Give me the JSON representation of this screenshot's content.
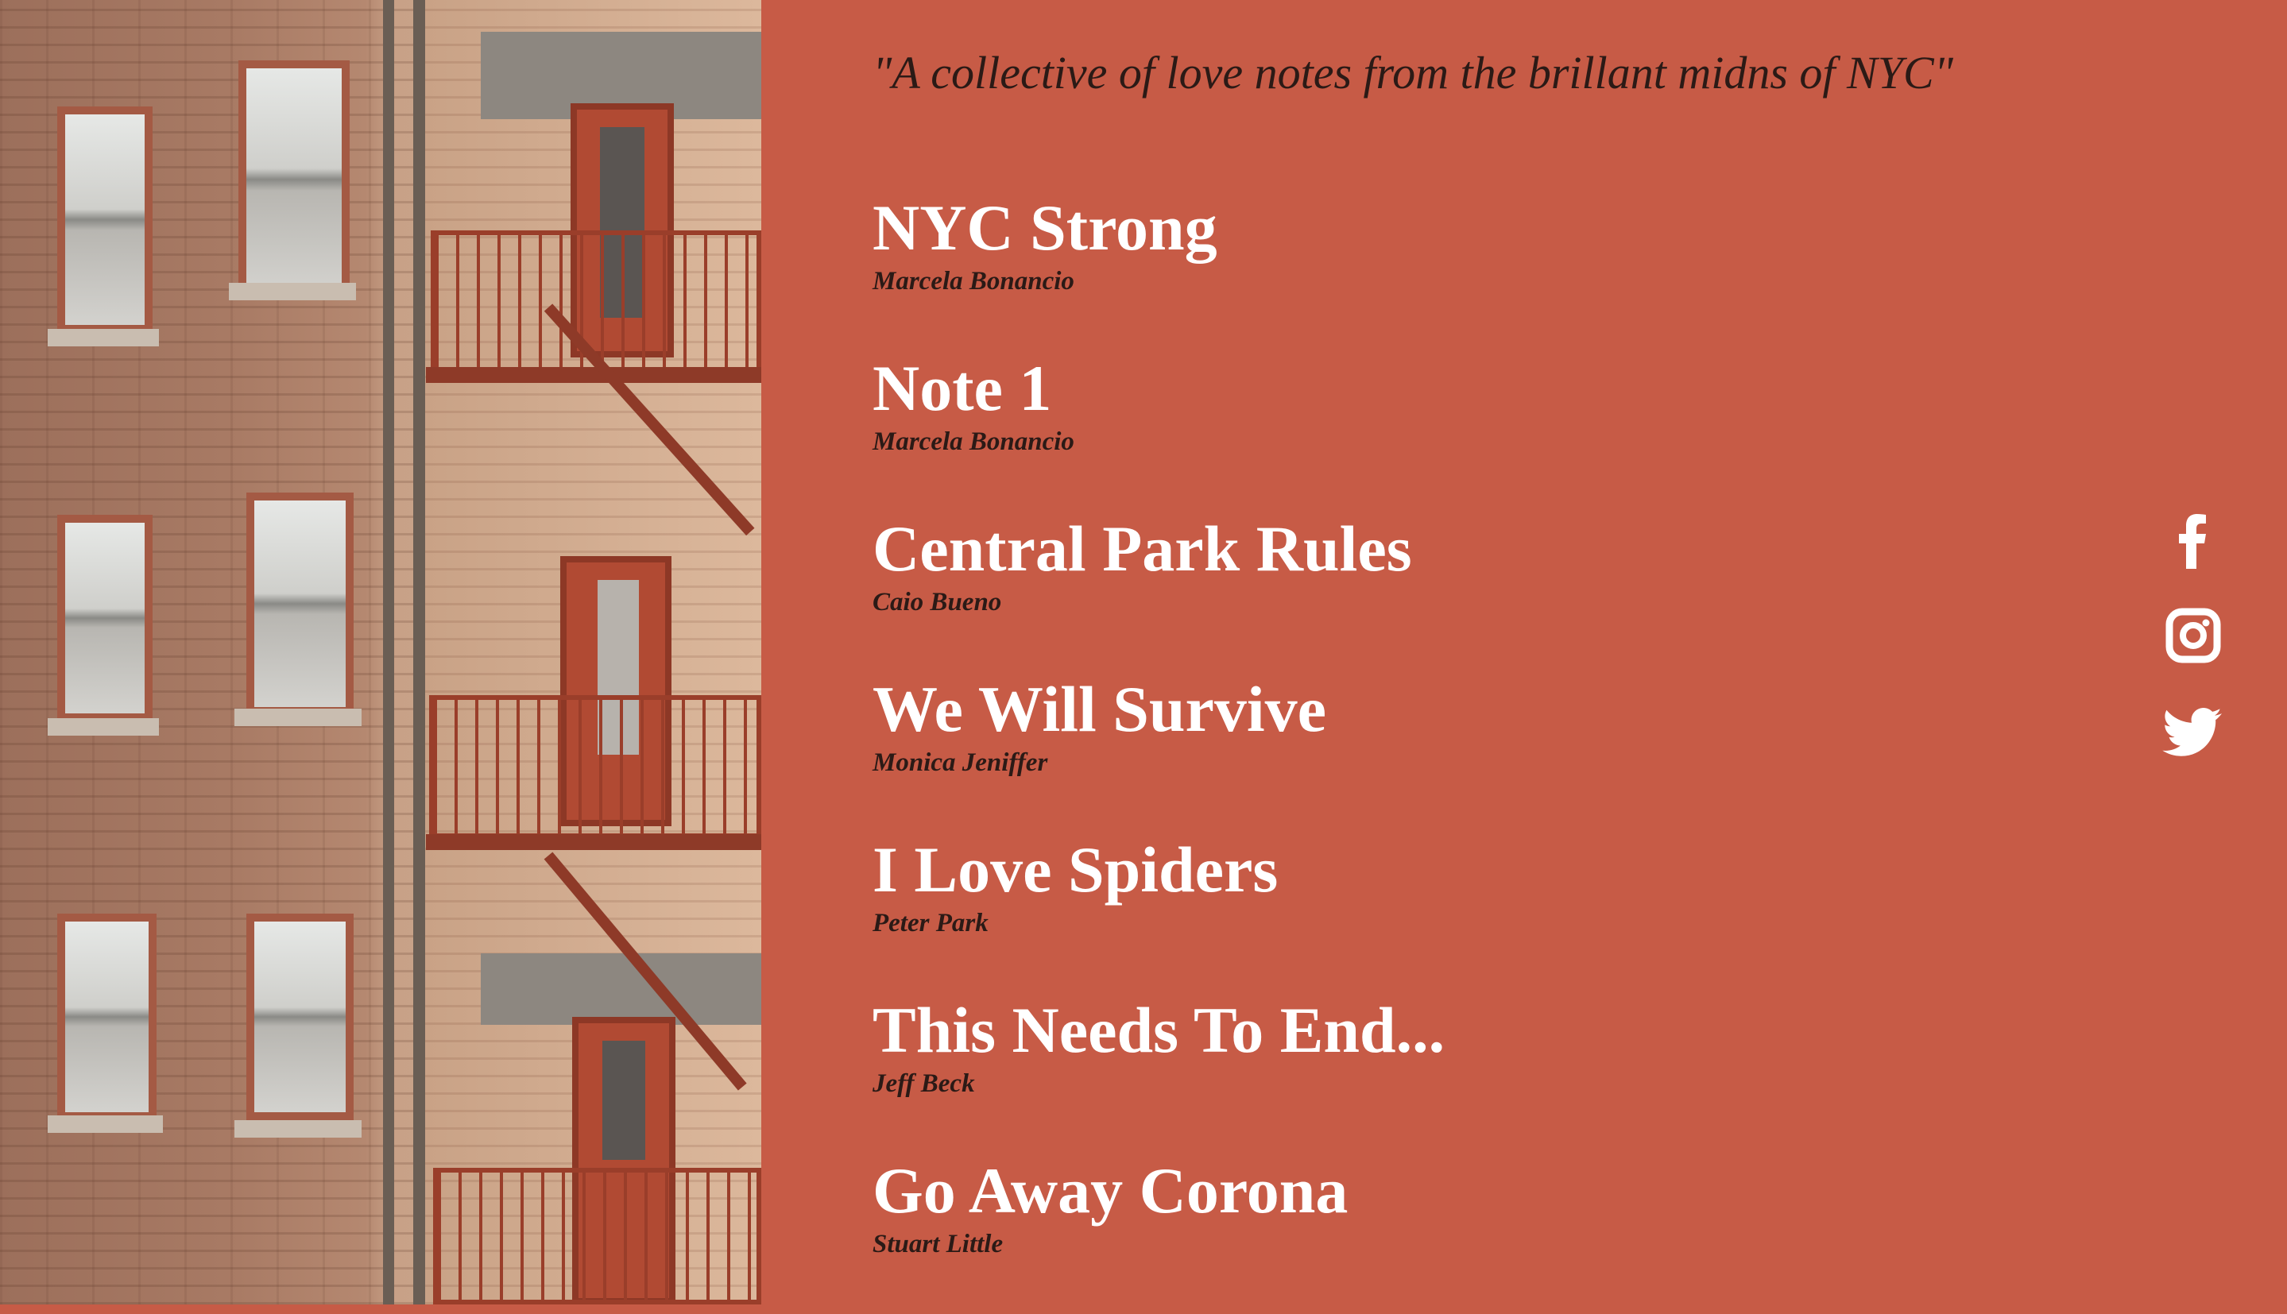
{
  "hero": {
    "image_alt": "brick apartment building with red fire escape"
  },
  "quote": "\"A collective of love notes from the brillant midns of NYC\"",
  "notes": [
    {
      "title": "NYC Strong",
      "author": "Marcela Bonancio"
    },
    {
      "title": "Note 1",
      "author": "Marcela Bonancio"
    },
    {
      "title": "Central Park Rules",
      "author": "Caio Bueno"
    },
    {
      "title": "We Will Survive",
      "author": "Monica Jeniffer"
    },
    {
      "title": "I Love Spiders",
      "author": "Peter Park"
    },
    {
      "title": "This Needs To End...",
      "author": "Jeff Beck"
    },
    {
      "title": "Go Away Corona",
      "author": "Stuart Little"
    }
  ],
  "social": [
    {
      "icon": "facebook-icon"
    },
    {
      "icon": "instagram-icon"
    },
    {
      "icon": "twitter-icon"
    }
  ],
  "colors": {
    "background": "#c75b46",
    "title_text": "#ffffff",
    "author_text": "#2b1a16",
    "fire_escape": "#9a3e2a"
  }
}
